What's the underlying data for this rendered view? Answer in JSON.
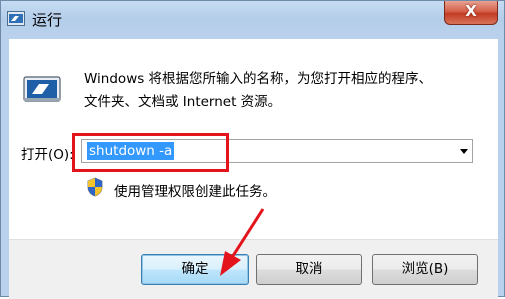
{
  "window": {
    "title": "运行",
    "close_symbol": "X"
  },
  "dialog": {
    "description_line1": "Windows 将根据您所输入的名称，为您打开相应的程序、",
    "description_line2": "文件夹、文档或 Internet 资源。",
    "open_label": "打开(O):",
    "command_value": "shutdown -a",
    "admin_note": "使用管理权限创建此任务。"
  },
  "buttons": {
    "ok": "确定",
    "cancel": "取消",
    "browse": "浏览(B)"
  },
  "icons": {
    "app": "run-icon",
    "run_large": "run-icon",
    "shield": "uac-shield-icon",
    "dropdown": "chevron-down-icon"
  },
  "annotation_colors": {
    "highlight": "#e3141b"
  }
}
